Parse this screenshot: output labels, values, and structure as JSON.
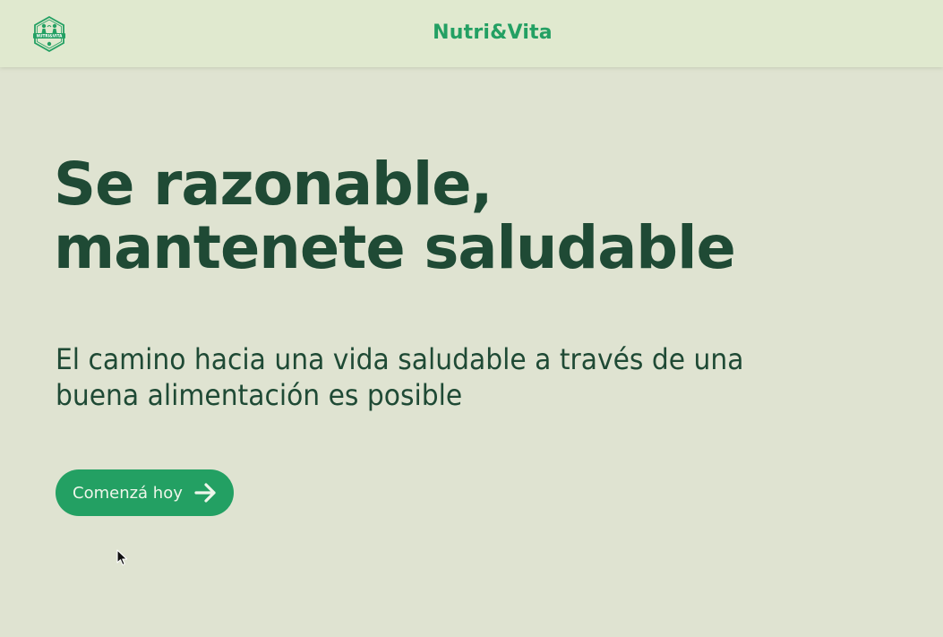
{
  "header": {
    "brand": "Nutri&Vita",
    "logo_icon": "nutrivita-logo-icon",
    "logo_text": "NUTRI&VITA"
  },
  "hero": {
    "headline_lines": [
      "Se razonable,",
      "mantenete saludable"
    ],
    "subhead_lines": [
      "El camino hacia una vida saludable a través de una",
      "buena alimentación es posible"
    ]
  },
  "cta": {
    "label": "Comenzá hoy",
    "icon": "arrow-right-icon"
  },
  "colors": {
    "background": "#dfe3d1",
    "header_background": "#e0e9cf",
    "accent": "#23a063",
    "headline": "#1f4a35",
    "button_text": "#eef6ea"
  }
}
